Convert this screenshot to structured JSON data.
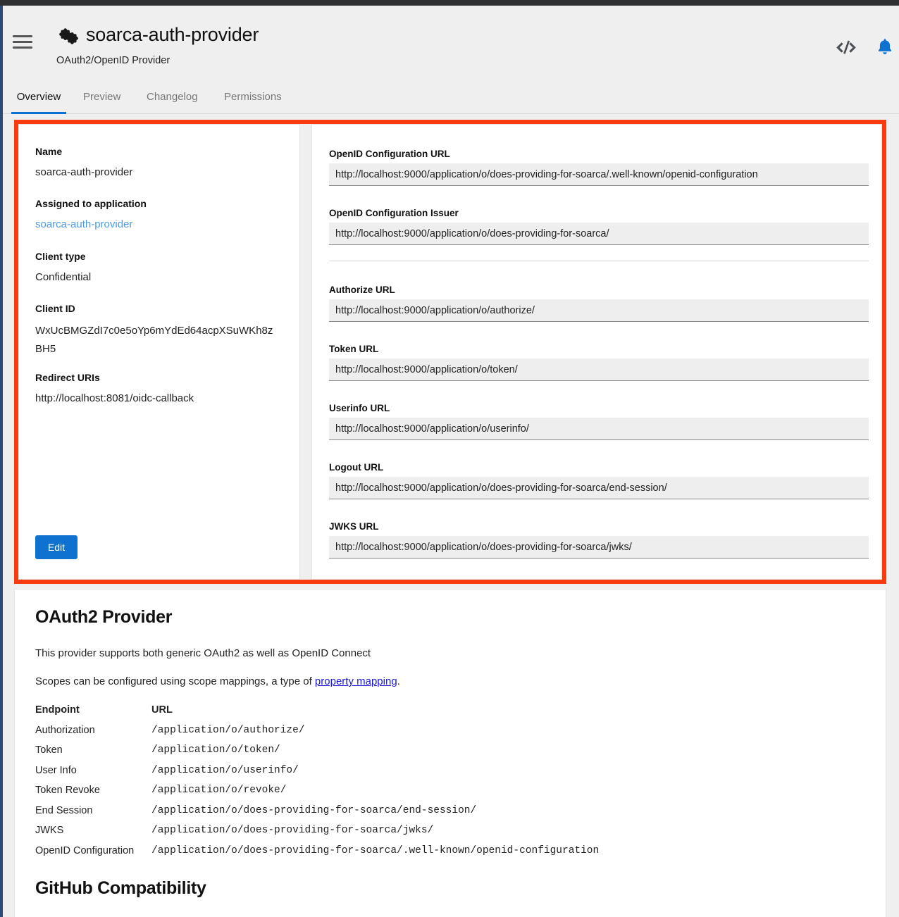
{
  "window": {
    "accent_blue": "#0b6fd4",
    "highlight_border": "#f93b10",
    "link_blue": "#4d9ae8"
  },
  "header": {
    "app_icon": "puzzle-icon",
    "menu_icon": "hamburger-menu-icon",
    "title": "soarca-auth-provider",
    "subtitle": "OAuth2/OpenID Provider",
    "code_icon": "code-brackets-icon",
    "notifications_icon": "bell-icon"
  },
  "tabs": [
    {
      "label": "Overview",
      "active": true
    },
    {
      "label": "Preview",
      "active": false
    },
    {
      "label": "Changelog",
      "active": false
    },
    {
      "label": "Permissions",
      "active": false
    }
  ],
  "details": {
    "fields": [
      {
        "label": "Name",
        "value": "soarca-auth-provider",
        "is_link": false
      },
      {
        "label": "Assigned to application",
        "value": "soarca-auth-provider",
        "is_link": true
      },
      {
        "label": "Client type",
        "value": "Confidential",
        "is_link": false
      },
      {
        "label": "Client ID",
        "value": "WxUcBMGZdI7c0e5oYp6mYdEd64acpXSuWKh8zBH5",
        "is_link": false
      },
      {
        "label": "Redirect URIs",
        "value": "http://localhost:8081/oidc-callback",
        "is_link": false
      }
    ],
    "edit_label": "Edit"
  },
  "urls": {
    "fields": [
      {
        "label": "OpenID Configuration URL",
        "value": "http://localhost:9000/application/o/does-providing-for-soarca/.well-known/openid-configuration"
      },
      {
        "label": "OpenID Configuration Issuer",
        "value": "http://localhost:9000/application/o/does-providing-for-soarca/"
      },
      {
        "label": "Authorize URL",
        "value": "http://localhost:9000/application/o/authorize/"
      },
      {
        "label": "Token URL",
        "value": "http://localhost:9000/application/o/token/"
      },
      {
        "label": "Userinfo URL",
        "value": "http://localhost:9000/application/o/userinfo/"
      },
      {
        "label": "Logout URL",
        "value": "http://localhost:9000/application/o/does-providing-for-soarca/end-session/"
      },
      {
        "label": "JWKS URL",
        "value": "http://localhost:9000/application/o/does-providing-for-soarca/jwks/"
      }
    ]
  },
  "docs": {
    "heading": "OAuth2 Provider",
    "paragraph1": "This provider supports both generic OAuth2 as well as OpenID Connect",
    "paragraph2_before": "Scopes can be configured using scope mappings, a type of ",
    "paragraph2_link": "property mapping",
    "paragraph2_after": ".",
    "table": {
      "headers": {
        "endpoint": "Endpoint",
        "url": "URL"
      },
      "rows": [
        {
          "endpoint": "Authorization",
          "url": "/application/o/authorize/"
        },
        {
          "endpoint": "Token",
          "url": "/application/o/token/"
        },
        {
          "endpoint": "User Info",
          "url": "/application/o/userinfo/"
        },
        {
          "endpoint": "Token Revoke",
          "url": "/application/o/revoke/"
        },
        {
          "endpoint": "End Session",
          "url": "/application/o/does-providing-for-soarca/end-session/"
        },
        {
          "endpoint": "JWKS",
          "url": "/application/o/does-providing-for-soarca/jwks/"
        },
        {
          "endpoint": "OpenID Configuration",
          "url": "/application/o/does-providing-for-soarca/.well-known/openid-configuration"
        }
      ]
    },
    "heading2": "GitHub Compatibility"
  }
}
